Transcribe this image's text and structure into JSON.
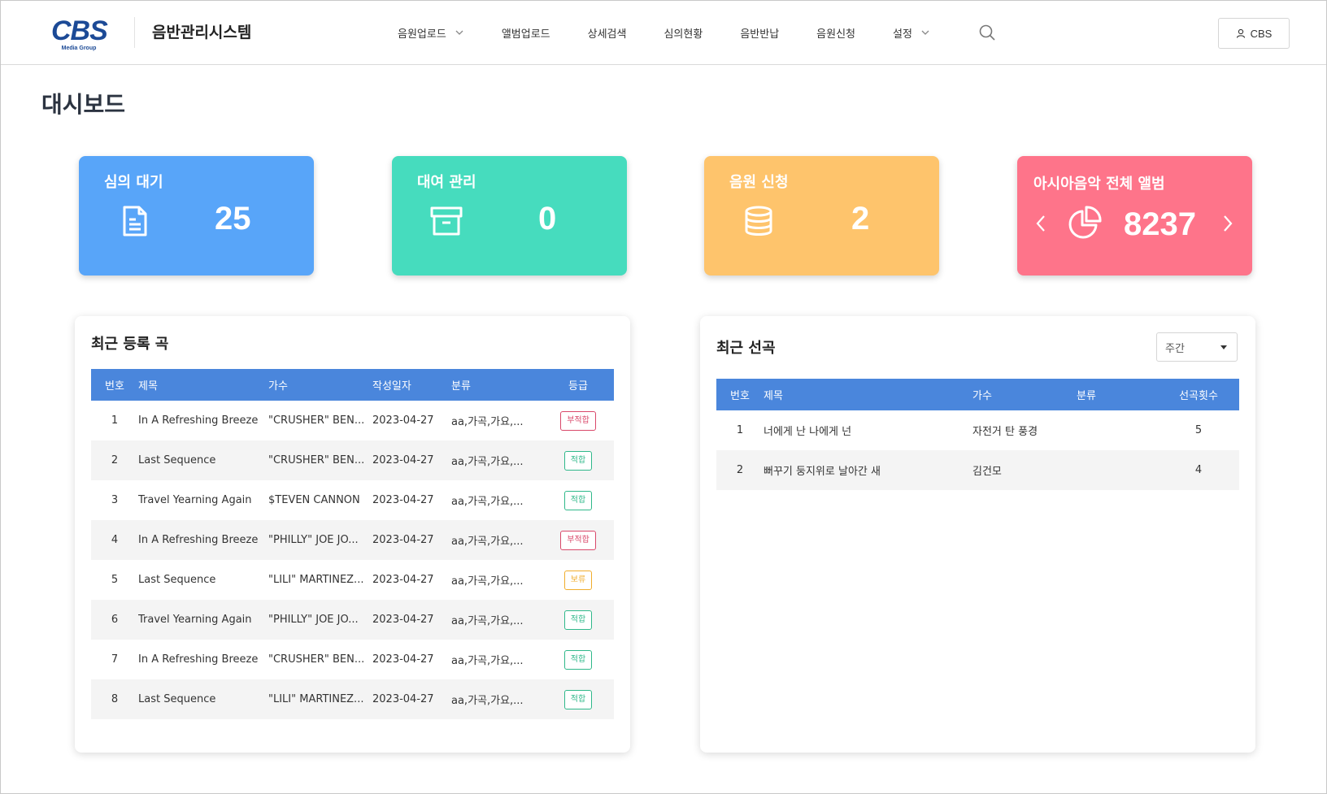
{
  "header": {
    "logo_text": "CBS",
    "logo_subtext": "Media Group",
    "app_title": "음반관리시스템",
    "nav": [
      {
        "label": "음원업로드",
        "has_dropdown": true
      },
      {
        "label": "앨범업로드",
        "has_dropdown": false
      },
      {
        "label": "상세검색",
        "has_dropdown": false
      },
      {
        "label": "심의현황",
        "has_dropdown": false
      },
      {
        "label": "음반반납",
        "has_dropdown": false
      },
      {
        "label": "음원신청",
        "has_dropdown": false
      },
      {
        "label": "설정",
        "has_dropdown": true
      }
    ],
    "search_icon": "search-icon",
    "user_label": "CBS",
    "user_icon": "user-icon"
  },
  "page": {
    "title": "대시보드"
  },
  "cards": [
    {
      "title": "심의 대기",
      "value": "25",
      "icon": "document-icon",
      "color": "#58a5f9"
    },
    {
      "title": "대여 관리",
      "value": "0",
      "icon": "archive-box-icon",
      "color": "#46dcbe"
    },
    {
      "title": "음원 신청",
      "value": "2",
      "icon": "database-icon",
      "color": "#fec46c"
    },
    {
      "title": "아시아음악 전체 앨범",
      "value": "8237",
      "icon": "pie-chart-icon",
      "color": "#fe748a"
    }
  ],
  "recent_songs": {
    "title": "최근 등록 곡",
    "columns": [
      "번호",
      "제목",
      "가수",
      "작성일자",
      "분류",
      "등급"
    ],
    "rows": [
      {
        "no": "1",
        "title": "In A Refreshing Breeze",
        "artist": "\"CRUSHER\" BEN...",
        "date": "2023-04-27",
        "category": "aa,가곡,가요,...",
        "grade": "부적합",
        "grade_type": "red"
      },
      {
        "no": "2",
        "title": "Last Sequence",
        "artist": "\"CRUSHER\" BEN...",
        "date": "2023-04-27",
        "category": "aa,가곡,가요,...",
        "grade": "적합",
        "grade_type": "green"
      },
      {
        "no": "3",
        "title": "Travel Yearning Again",
        "artist": "$TEVEN CANNON",
        "date": "2023-04-27",
        "category": "aa,가곡,가요,...",
        "grade": "적합",
        "grade_type": "green"
      },
      {
        "no": "4",
        "title": "In A Refreshing Breeze",
        "artist": "\"PHILLY\" JOE JO...",
        "date": "2023-04-27",
        "category": "aa,가곡,가요,...",
        "grade": "부적합",
        "grade_type": "red"
      },
      {
        "no": "5",
        "title": "Last Sequence",
        "artist": "\"LILI\" MARTINEZ...",
        "date": "2023-04-27",
        "category": "aa,가곡,가요,...",
        "grade": "보류",
        "grade_type": "yellow"
      },
      {
        "no": "6",
        "title": "Travel Yearning Again",
        "artist": "\"PHILLY\" JOE JO...",
        "date": "2023-04-27",
        "category": "aa,가곡,가요,...",
        "grade": "적합",
        "grade_type": "green"
      },
      {
        "no": "7",
        "title": "In A Refreshing Breeze",
        "artist": "\"CRUSHER\" BEN...",
        "date": "2023-04-27",
        "category": "aa,가곡,가요,...",
        "grade": "적합",
        "grade_type": "green"
      },
      {
        "no": "8",
        "title": "Last Sequence",
        "artist": "\"LILI\" MARTINEZ...",
        "date": "2023-04-27",
        "category": "aa,가곡,가요,...",
        "grade": "적합",
        "grade_type": "green"
      }
    ]
  },
  "recent_selections": {
    "title": "최근 선곡",
    "period_selected": "주간",
    "columns": [
      "번호",
      "제목",
      "가수",
      "분류",
      "선곡횟수"
    ],
    "rows": [
      {
        "no": "1",
        "title": "너에게 난 나에게 넌",
        "artist": "자전거 탄 풍경",
        "category": "",
        "count": "5"
      },
      {
        "no": "2",
        "title": "뻐꾸기 둥지위로 날아간 새",
        "artist": "김건모",
        "category": "",
        "count": "4"
      }
    ]
  }
}
